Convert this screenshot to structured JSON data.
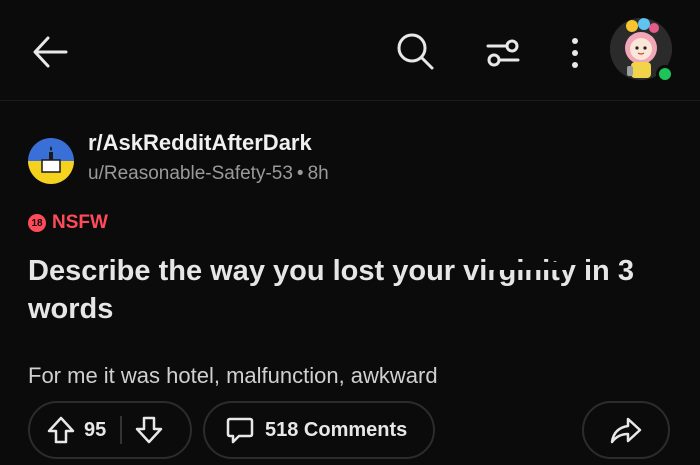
{
  "header": {
    "icons": [
      "back-arrow-icon",
      "search-icon",
      "filter-icon",
      "more-vertical-icon",
      "avatar"
    ]
  },
  "post": {
    "subreddit": "r/AskRedditAfterDark",
    "author": "u/Reasonable-Safety-53",
    "separator": "•",
    "age": "8h",
    "nsfw_badge": "18",
    "nsfw_label": "NSFW",
    "title": "Describe the way you lost your virginity in 3 words",
    "body": "For me it was hotel, malfunction, awkward"
  },
  "actions": {
    "upvotes": "95",
    "comments_label": "518 Comments"
  },
  "colors": {
    "background": "#0b0b0b",
    "nsfw": "#ff4b59",
    "online": "#1ec35a",
    "subreddit_icon_top": "#3a6fd8",
    "subreddit_icon_bottom": "#f5d21e"
  }
}
